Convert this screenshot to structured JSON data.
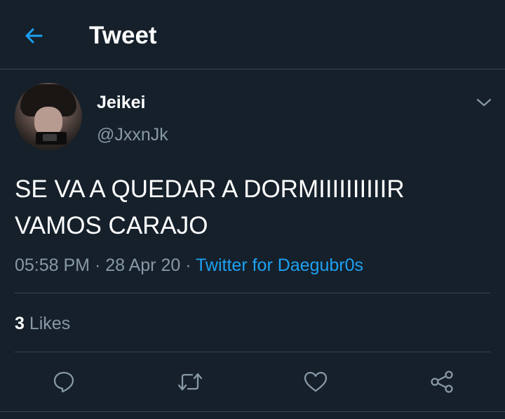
{
  "header": {
    "title": "Tweet",
    "back_icon": "back-arrow-icon"
  },
  "author": {
    "display_name": "Jeikei",
    "handle": "@JxxnJk"
  },
  "tweet": {
    "text_lines": [
      "SE VA A QUEDAR A DORMIIIIIIIIIIR",
      "VAMOS CARAJO"
    ],
    "time": "05:58 PM",
    "sep1": " · ",
    "date": "28 Apr 20",
    "sep2": " · ",
    "source": "Twitter for Daegubr0s"
  },
  "stats": {
    "likes_count": "3",
    "likes_label": " Likes"
  },
  "actions": [
    "reply-icon",
    "retweet-icon",
    "like-icon",
    "share-icon"
  ],
  "colors": {
    "background": "#15202b",
    "accent": "#1da1f2",
    "secondary_text": "#8899a6",
    "divider": "#38444d"
  }
}
